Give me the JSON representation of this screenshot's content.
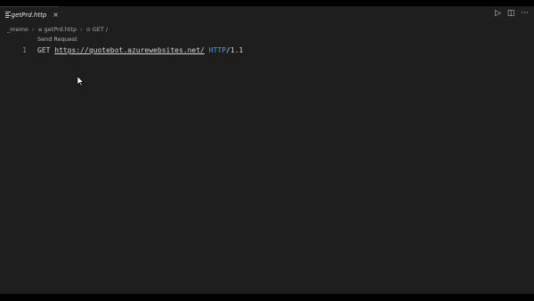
{
  "tab": {
    "label": "getPrd.http",
    "close_glyph": "×"
  },
  "title_actions": [
    {
      "name": "run-icon",
      "glyph": "▷"
    },
    {
      "name": "split-editor-icon",
      "glyph": "◫"
    },
    {
      "name": "more-actions-icon",
      "glyph": "···"
    }
  ],
  "breadcrumb": {
    "folder": "_memo",
    "file": "getPrd.http",
    "symbol": "GET /"
  },
  "codelens": "Send Request",
  "editor": {
    "line_number": "1",
    "method": "GET",
    "url": "https://quotebot.azurewebsites.net/",
    "protocol": "HTTP",
    "version": "/1.1"
  }
}
